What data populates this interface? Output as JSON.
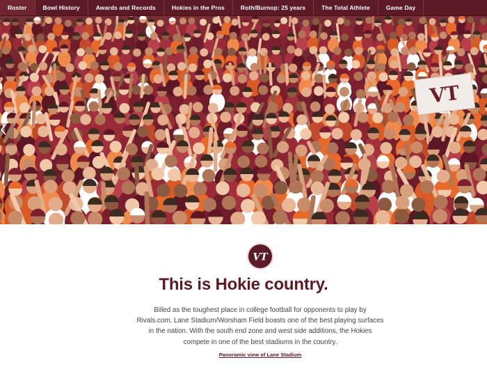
{
  "nav": {
    "items": [
      {
        "label": "Roster"
      },
      {
        "label": "Bowl History"
      },
      {
        "label": "Awards and Records"
      },
      {
        "label": "Hokies in the Pros"
      },
      {
        "label": "Roth/Burnop: 25 years"
      },
      {
        "label": "The Total Athlete"
      },
      {
        "label": "Game Day"
      }
    ]
  },
  "hero": {
    "image_description": "crowd-of-fans-photo",
    "banner_text": "VT",
    "prev_icon": "chevron-left-icon"
  },
  "logo": {
    "icon": "vt-logo-icon",
    "text": "VT"
  },
  "content": {
    "headline": "This is Hokie country.",
    "body": "Billed as the toughest place in college football for opponents to play by Rivals.com, Lane Stadium/Worsham Field boasts one of the best playing surfaces in the nation. With the south end zone and west side additions, the Hokies compete in one of the best stadiums in the country.",
    "link": "Panoramic view of Lane Stadium"
  },
  "colors": {
    "maroon": "#5b1a25",
    "orange": "#e8692a",
    "body_text": "#444444"
  }
}
